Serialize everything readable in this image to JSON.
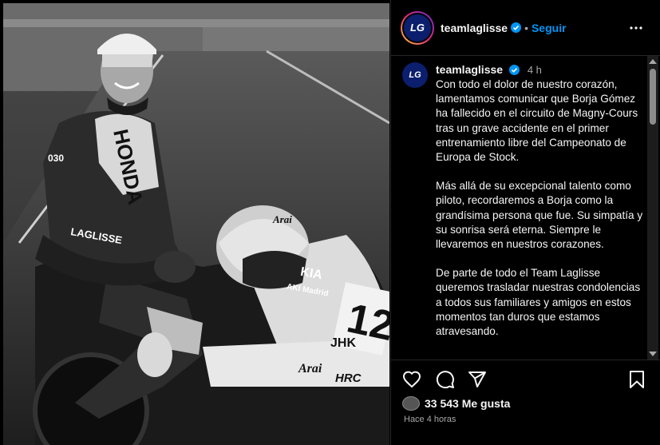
{
  "post": {
    "username": "teamlaglisse",
    "follow_label": "Seguir",
    "dot": "•",
    "avatar_text": "LG",
    "caption": {
      "username": "teamlaglisse",
      "time": "4 h",
      "paragraphs": [
        "Con todo el dolor de nuestro corazón, lamentamos comunicar que Borja Gómez ha fallecido en el circuito de Magny-Cours tras un grave accidente en el primer entrenamiento libre del Campeonato de Europa de Stock.",
        "Más allá de su excepcional talento como piloto, recordaremos a Borja como la grandísima persona que fue. Su simpatía y su sonrisa será eterna. Siempre le llevaremos en nuestros corazones.",
        "De parte de todo el Team Laglisse queremos trasladar nuestras condolencias a todos sus familiares y amigos en estos momentos tan duros que estamos atravesando."
      ]
    },
    "likes": "33 543 Me gusta",
    "timestamp": "Hace 4 horas"
  },
  "photo": {
    "number": "12",
    "sponsor_honda": "HONDA",
    "sponsor_arai": "Arai",
    "sponsor_laglisse": "LAGLISSE",
    "sponsor_kia": "KIA",
    "sponsor_aki": "AKI Madrid",
    "sponsor_jhk": "JHK",
    "sponsor_hrc": "HRC",
    "sponsor_030": "030"
  },
  "icons": {
    "like": "heart-icon",
    "comment": "comment-icon",
    "share": "share-icon",
    "save": "bookmark-icon",
    "more": "more-options-icon",
    "verified": "verified-badge-icon"
  },
  "colors": {
    "follow": "#0095f6",
    "verified": "#0095f6",
    "background": "#000000",
    "secondary_text": "#a8a8a8"
  }
}
